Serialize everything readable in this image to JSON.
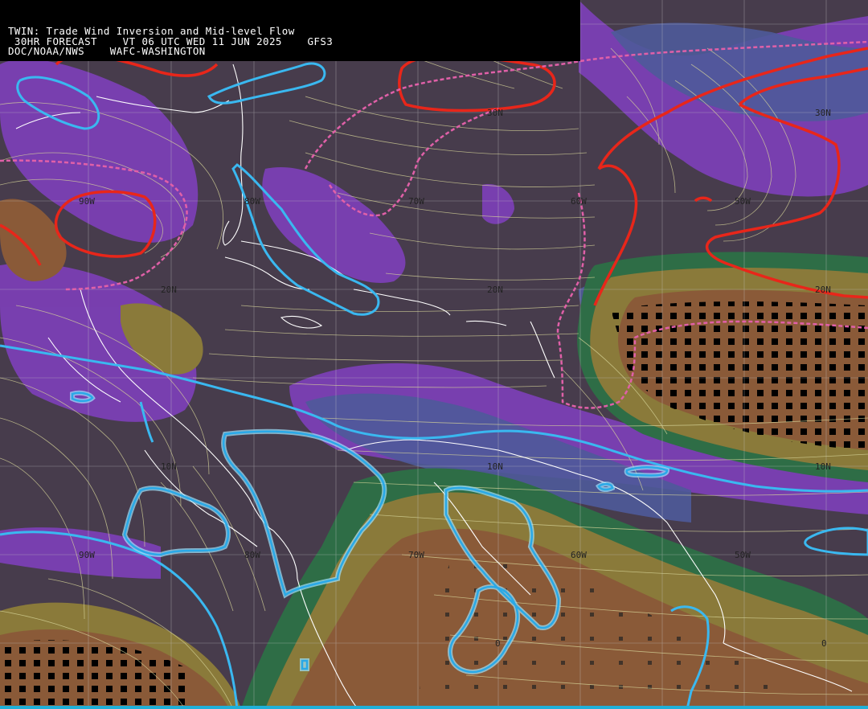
{
  "header": {
    "line1": "TWIN: Trade Wind Inversion and Mid-level Flow",
    "line2": " 30HR FORECAST    VT 06 UTC WED 11 JUN 2025    GFS3",
    "line3": "DOC/NOAA/NWS    WAFC-WASHINGTON"
  },
  "grid_labels": {
    "lat_30n_center": "30N",
    "lat_30n_east": "30N",
    "lon_90w_north": "90W",
    "lon_80w_north": "80W",
    "lon_70w_north": "70W",
    "lon_60w_north": "60W",
    "lon_50w_north": "50W",
    "lat_20n_west": "20N",
    "lat_20n_center": "20N",
    "lat_20n_east": "20N",
    "lat_10n_west": "10N",
    "lat_10n_center": "10N",
    "lat_10n_east": "10N",
    "lon_90w_south": "90W",
    "lon_80w_south": "80W",
    "lon_70w_south": "70W",
    "lon_60w_south": "60W",
    "lon_50w_south": "50W",
    "lat_0_center": "0",
    "lat_0_east": "0"
  },
  "colors": {
    "background_dark": "#473c4c",
    "purple": "#7b3fb4",
    "blue_gray": "#4e5a9a",
    "dark_green": "#2e6d46",
    "green": "#4e8b3a",
    "olive": "#8a7a3a",
    "brown": "#8a5a38",
    "contour_red": "#e8261a",
    "contour_pink": "#e060a8",
    "contour_cyan": "#3ab8f0",
    "streamline": "#d8d69a",
    "coastline": "#ffffff"
  }
}
